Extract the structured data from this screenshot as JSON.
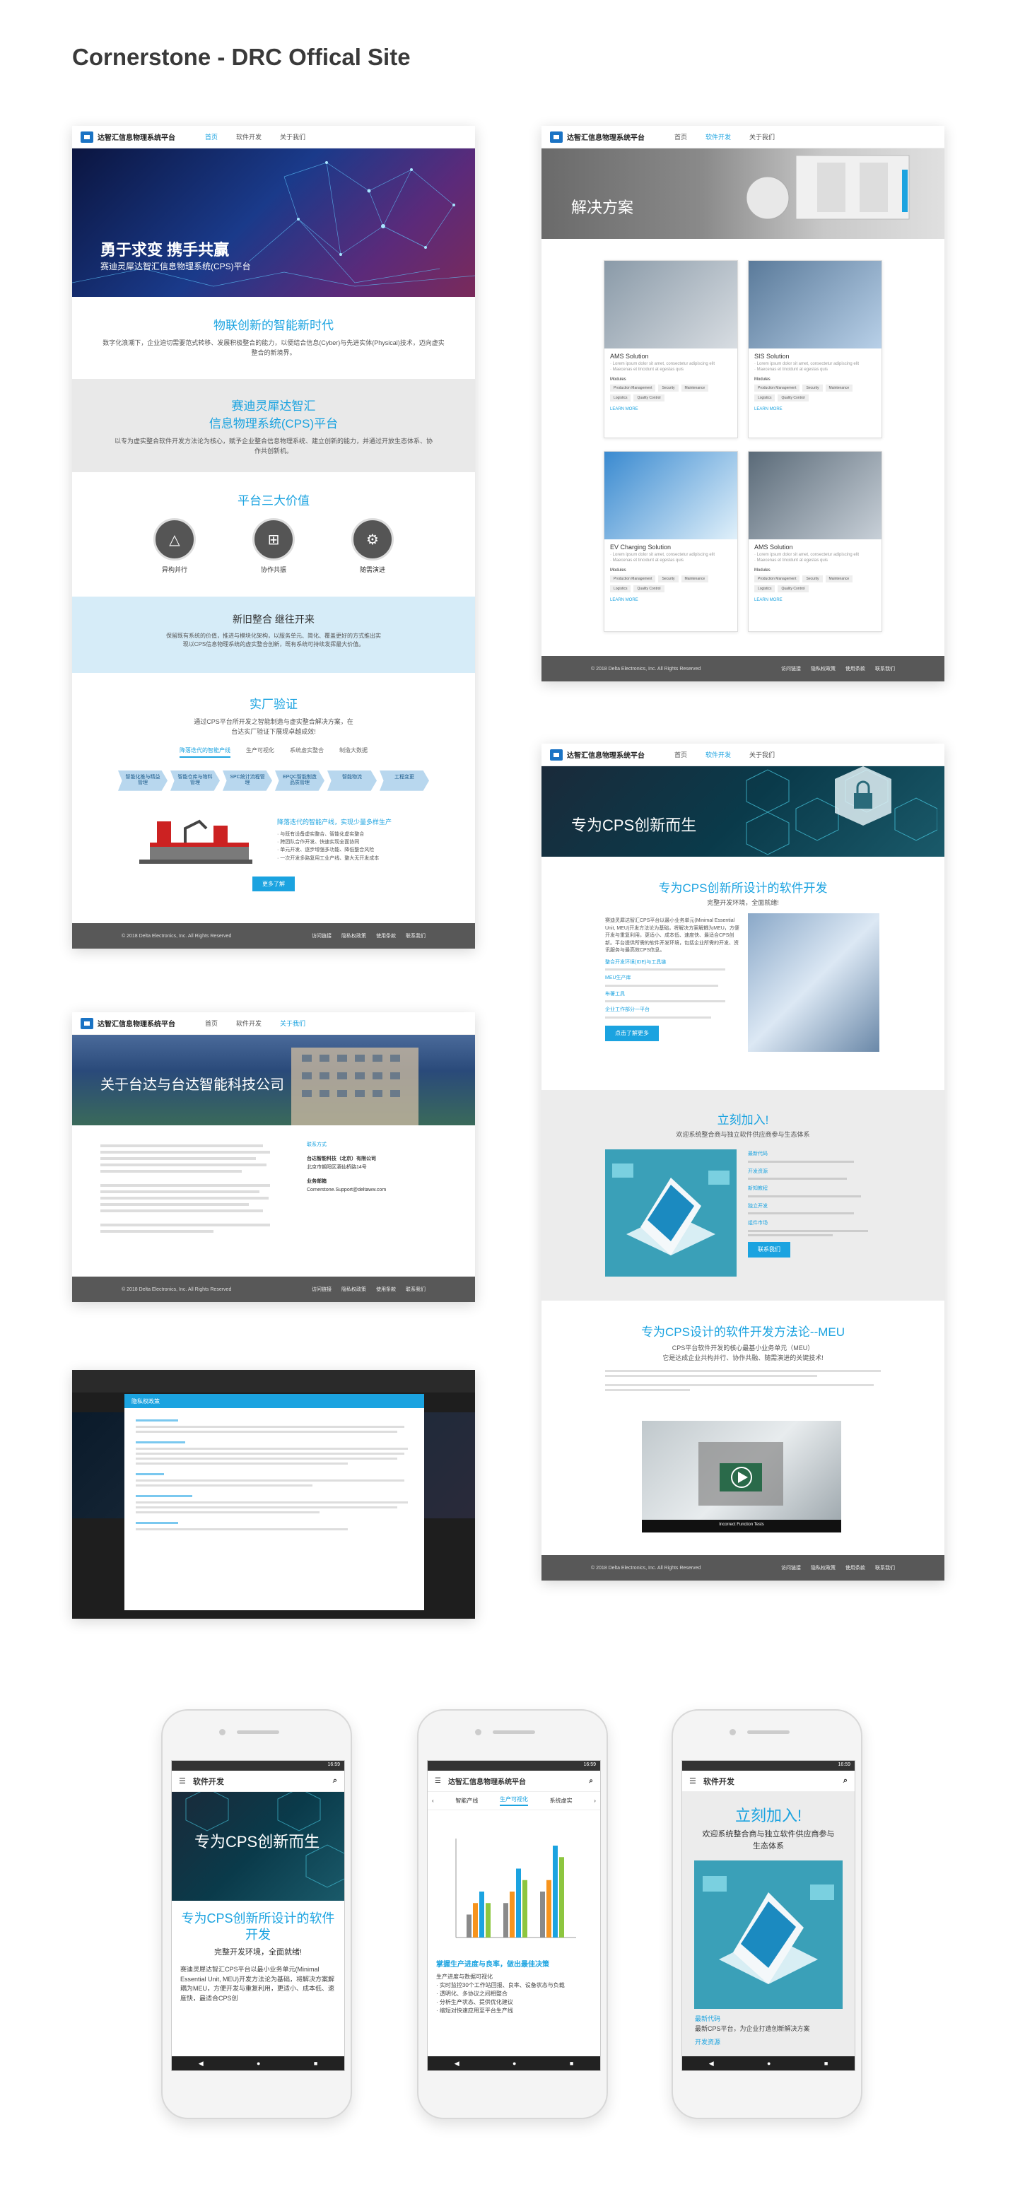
{
  "page": {
    "title": "Cornerstone - DRC Offical Site"
  },
  "common": {
    "brand": "达智汇信息物理系统平台",
    "nav": [
      "首页",
      "软件开发",
      "关于我们"
    ],
    "copyright": "© 2018 Delta Electronics, Inc. All Rights Reserved",
    "footer_links": [
      "访问链接",
      "隐私权政策",
      "使用条款",
      "联系我们"
    ]
  },
  "home": {
    "hero_title": "勇于求变  携手共赢",
    "hero_sub": "赛迪灵犀达智汇信息物理系统(CPS)平台",
    "s1_title": "物联创新的智能新时代",
    "s1_text": "数字化浪潮下，企业迫切需要范式转移、发展积极整合的能力，以便结合信息(Cyber)与先进实体(Physical)技术，迈向虚实整合的新境界。",
    "s2_title_a": "赛迪灵犀达智汇",
    "s2_title_b": "信息物理系统(CPS)平台",
    "s2_text": "以专为虚实整合软件开发方法论为核心，赋予企业整合信息物理系统、建立创新的能力，并通过开放生态体系、协作共创新机。",
    "s3_title": "平台三大价值",
    "values": [
      {
        "icon": "triangle-icon",
        "label": "异构并行"
      },
      {
        "icon": "flow-icon",
        "label": "协作共振"
      },
      {
        "icon": "gear-icon",
        "label": "随需演进"
      }
    ],
    "s4_title": "新旧整合 继往开来",
    "s4_text": "保留既有系统的价值，推进与模块化架构，以服务单元、简化、覆盖更好的方式推出实现以CPS信息物理系统的虚实整合创新，既有系统可持续发挥最大价值。",
    "s5_title": "实厂验证",
    "s5_text": "通过CPS平台所开发之智能制造与虚实整合解决方案，在台达实厂验证下展现卓越成效!",
    "tabs": [
      "降落迭代的智能产线",
      "生产可视化",
      "系统虚实整合",
      "制造大数据"
    ],
    "chevrons": [
      "智能化推与精益管理",
      "智能仓库与物料管理",
      "SPC统计流程管理",
      "EPQC智能制造品质管理",
      "智能物流",
      "工程变更"
    ],
    "case_title": "降落迭代的智能产线，实现少量多样生产",
    "case_text": "· 与既有设备虚实整合、智能化虚实整合\n· 跨团队合作开发、快速实现全面协同\n· 单元开发、逐步增强多功能、降低整合风险\n· 一次开发多路复用工业产线、整大无开发成本",
    "case_btn": "更多了解"
  },
  "solutions": {
    "hero_title": "解决方案",
    "cards": [
      {
        "title": "AMS Solution",
        "desc": "· Lorem ipsum dolor sit amet, consectetur adipiscing elit\n· Maecenas et tincidunt at egestas quis",
        "modules": "Modules",
        "tags": [
          "Production Management",
          "Security",
          "Maintenance",
          "Logistics",
          "Quality Control"
        ],
        "more": "LEARN MORE"
      },
      {
        "title": "SIS Solution",
        "desc": "· Lorem ipsum dolor sit amet, consectetur adipiscing elit\n· Maecenas et tincidunt at egestas quis",
        "modules": "Modules",
        "tags": [
          "Production Management",
          "Security",
          "Maintenance",
          "Logistics",
          "Quality Control"
        ],
        "more": "LEARN MORE"
      },
      {
        "title": "EV Charging Solution",
        "desc": "· Lorem ipsum dolor sit amet, consectetur adipiscing elit\n· Maecenas et tincidunt at egestas quis",
        "modules": "Modules",
        "tags": [
          "Production Management",
          "Security",
          "Maintenance",
          "Logistics",
          "Quality Control"
        ],
        "more": "LEARN MORE"
      },
      {
        "title": "AMS Solution",
        "desc": "· Lorem ipsum dolor sit amet, consectetur adipiscing elit\n· Maecenas et tincidunt at egestas quis",
        "modules": "Modules",
        "tags": [
          "Production Management",
          "Security",
          "Maintenance",
          "Logistics",
          "Quality Control"
        ],
        "more": "LEARN MORE"
      }
    ]
  },
  "software": {
    "hero_title": "专为CPS创新而生",
    "s1_title": "专为CPS创新所设计的软件开发",
    "s1_sub": "完整开发环境，全面就绪!",
    "s1_text": "赛迪灵犀达智汇CPS平台以最小业务单元(Minimal Essential Unit, MEU)开发方法论为基础，将解决方案解耦为MEU，方便开发与重复利用，更适小、成本低、速度快、最适合CPS创新。平台提供所需的软件开发环境，包括企业所需的开发、资讯服务与最高效CPS信息。",
    "s1_links": [
      "整合开发环境(IDE)与工具链",
      "MEU生产库",
      "布署工具",
      "企业工作部分一平台"
    ],
    "s1_btn": "点击了解更多",
    "s2_title": "立刻加入!",
    "s2_sub": "欢迎系统整合商与独立软件供应商参与生态体系",
    "s2_items": [
      "最新代码",
      "开发资源",
      "新知教程",
      "独立开发",
      "组件市场"
    ],
    "s2_btn": "联系我们",
    "s3_title": "专为CPS设计的软件开发方法论--MEU",
    "s3_sub_a": "CPS平台软件开发的核心最基小业务单元（MEU）",
    "s3_sub_b": "它是达成企业共构并行、协作共融、随需演进的关键技术!",
    "video_caption": "Incorrect Function Tests"
  },
  "about": {
    "hero_title": "关于台达与台达智能科技公司",
    "contact_head": "联系方式",
    "contact_company": "台达智能科技（北京）有限公司",
    "contact_addr": "北京市朝阳区酒仙桥路14号",
    "contact_email_label": "业务邮箱",
    "contact_email": "Cornerstone.Support@deltaww.com"
  },
  "modal": {
    "header": "隐私权政策"
  },
  "mobile": {
    "phone1_appbar": "软件开发",
    "phone1_hero": "专为CPS创新而生",
    "phone1_title": "专为CPS创新所设计的软件开发",
    "phone1_sub": "完整开发环境，全面就绪!",
    "phone1_text": "赛迪灵犀达智汇CPS平台以最小业务单元(Minimal Essential Unit, MEU)开发方法论为基础，将解决方案解耦为MEU，方便开发与重复利用，更适小、成本低、速度快，最适合CPS创",
    "phone2_appbar": "达智汇信息物理系统平台",
    "phone2_tabs": [
      "智能产线",
      "生产可视化",
      "系统虚实"
    ],
    "phone2_title": "掌握生产进度与良率，做出最佳决策",
    "phone2_text": "生产进度与数据可视化\n· 实时监控30个工作站回报、良率、设备状态与负载\n· 透明化、多协议之间相整合\n· 分析生产状态、提供优化建议\n· 缩短对快速应用至平台生产线",
    "phone2_chart": {
      "type": "bar",
      "series": [
        {
          "color": "#8a8a8a",
          "values": [
            2,
            3,
            4
          ]
        },
        {
          "color": "#f7941d",
          "values": [
            3,
            4,
            5
          ]
        },
        {
          "color": "#1ba3e0",
          "values": [
            4,
            6,
            8
          ]
        },
        {
          "color": "#8dc63f",
          "values": [
            3,
            5,
            7
          ]
        }
      ]
    },
    "phone3_appbar": "软件开发",
    "phone3_title": "立刻加入!",
    "phone3_sub": "欢迎系统整合商与独立软件供应商参与生态体系",
    "phone3_item": "最新代码",
    "phone3_item_text": "最新CPS平台，为企业打造创新解决方案",
    "phone3_item2": "开发资源",
    "status_time": "16:59"
  }
}
